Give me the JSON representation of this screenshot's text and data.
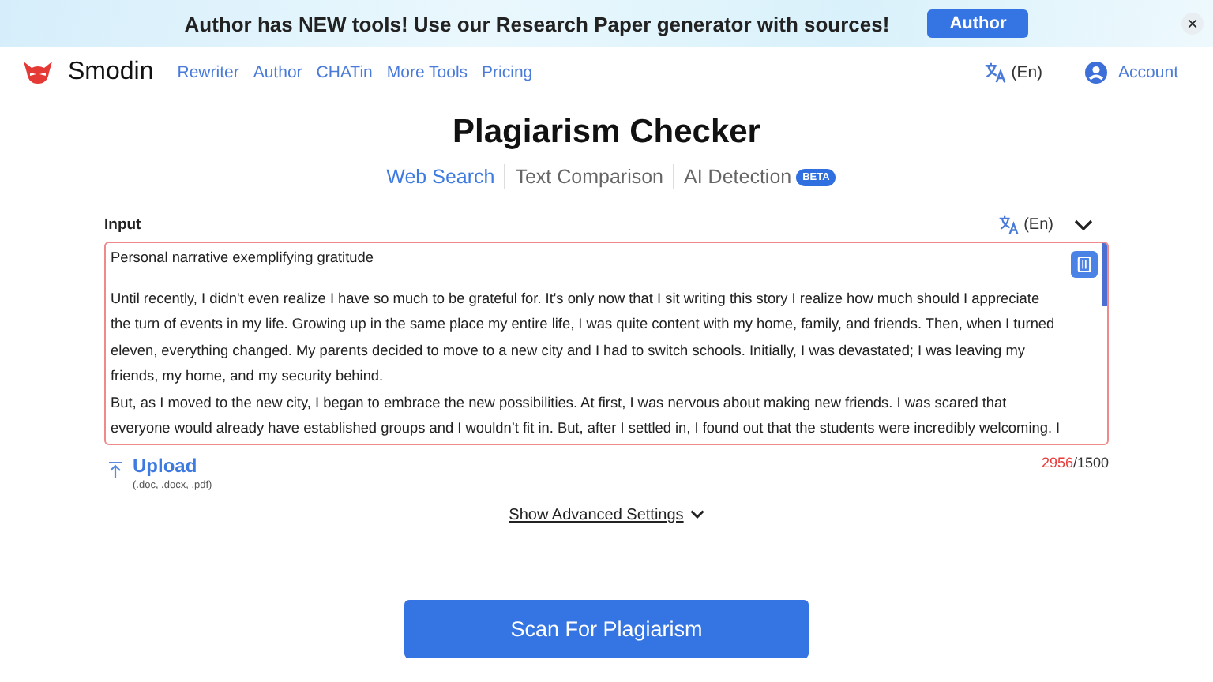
{
  "banner": {
    "message": "Author has NEW tools! Use our Research Paper generator with sources!",
    "button": "Author",
    "close": "×"
  },
  "nav": {
    "brand": "Smodin",
    "links": [
      "Rewriter",
      "Author",
      "CHATin",
      "More Tools",
      "Pricing"
    ],
    "language": "(En)",
    "account": "Account"
  },
  "title": "Plagiarism Checker",
  "tabs": [
    {
      "label": "Web Search",
      "selected": true
    },
    {
      "label": "Text Comparison",
      "selected": false
    },
    {
      "label": "AI Detection",
      "selected": false,
      "badge": "BETA"
    }
  ],
  "input": {
    "label": "Input",
    "language": "(En)",
    "over_limit": true,
    "heading": "Personal narrative exemplifying gratitude",
    "lines": [
      "Until recently, I didn't even realize I have so much to be grateful for. It's only now that I sit writing this story I realize how much should I appreciate",
      "the turn of events in my life. Growing up in the same place my entire life, I was quite content with my home, family, and friends. Then, when I turned",
      "eleven, everything changed. My parents decided to move to a new city and I had to switch schools. Initially, I was devastated; I was leaving my",
      "friends, my home, and my security behind.",
      "But, as I moved to the new city, I began to embrace the new possibilities. At first, I was nervous about making new friends. I was scared that",
      "everyone would already have established groups and I wouldn’t fit in. But, after I settled in, I found out that the students were incredibly welcoming. I"
    ],
    "count": "2956",
    "limit": "/1500"
  },
  "upload": {
    "label": "Upload",
    "formats": "(.doc, .docx, .pdf)"
  },
  "advanced": "Show Advanced Settings",
  "scan_button": "Scan For Plagiarism"
}
